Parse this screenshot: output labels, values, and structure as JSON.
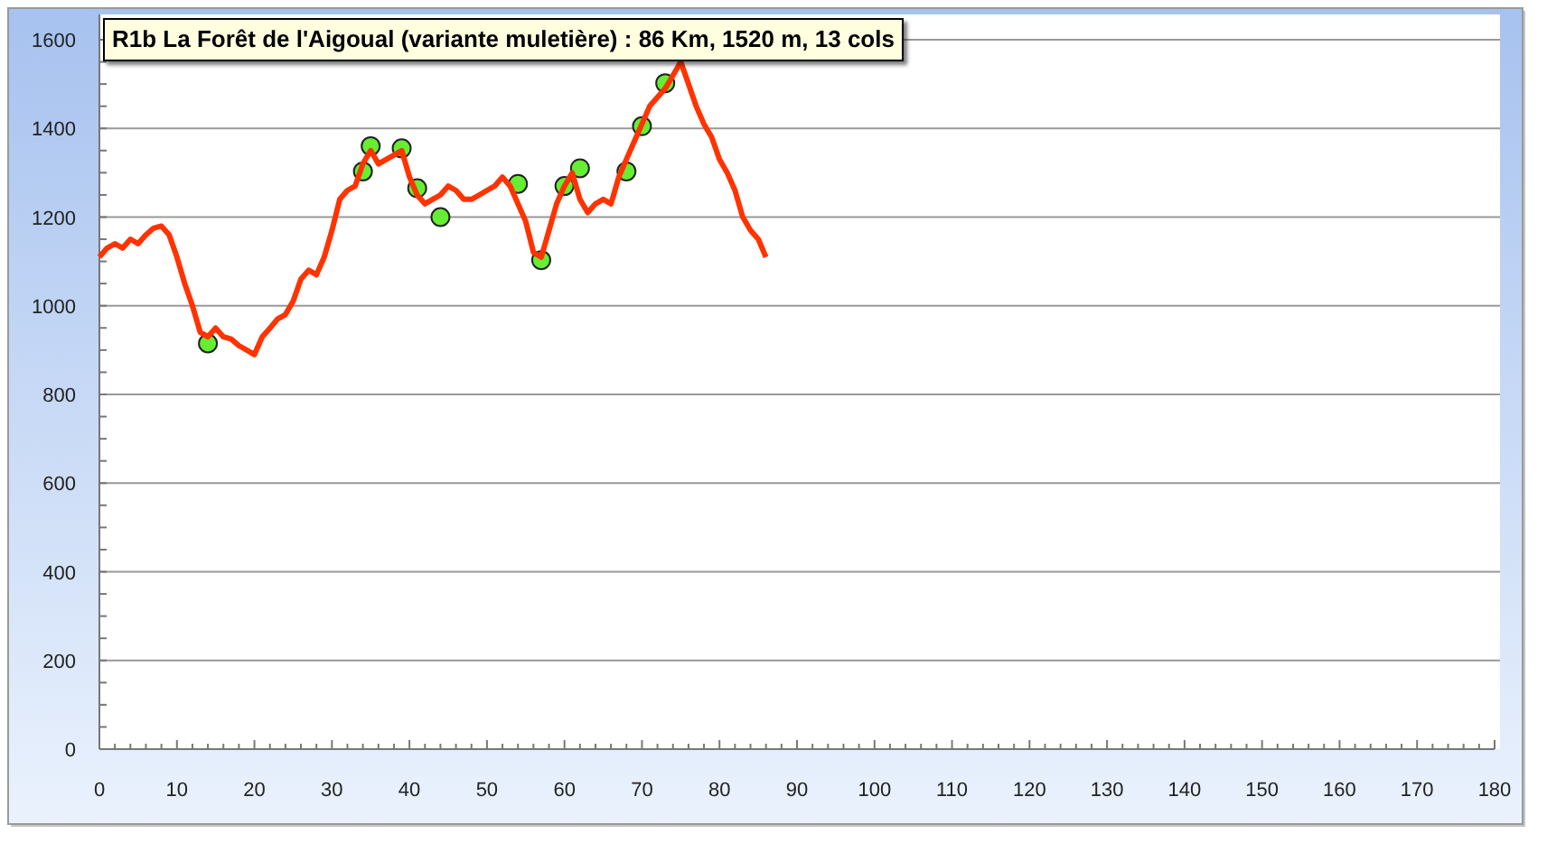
{
  "title": "R1b La Forêt de l'Aigoual (variante muletière) : 86 Km, 1520  m, 13 cols",
  "chart_data": {
    "type": "line",
    "x": [
      0,
      1,
      2,
      3,
      4,
      5,
      6,
      7,
      8,
      9,
      10,
      11,
      12,
      13,
      14,
      15,
      16,
      17,
      18,
      19,
      20,
      21,
      22,
      23,
      24,
      25,
      26,
      27,
      28,
      29,
      30,
      31,
      32,
      33,
      34,
      35,
      36,
      37,
      38,
      39,
      40,
      41,
      42,
      43,
      44,
      45,
      46,
      47,
      48,
      49,
      50,
      51,
      52,
      53,
      54,
      55,
      56,
      57,
      58,
      59,
      60,
      61,
      62,
      63,
      64,
      65,
      66,
      67,
      68,
      69,
      70,
      71,
      72,
      73,
      74,
      75,
      76,
      77,
      78,
      79,
      80,
      81,
      82,
      83,
      84,
      85,
      86
    ],
    "series": [
      {
        "type": "line",
        "color": "#ff3300",
        "values": [
          1110,
          1130,
          1140,
          1130,
          1150,
          1140,
          1160,
          1175,
          1180,
          1160,
          1110,
          1050,
          1000,
          940,
          930,
          950,
          930,
          925,
          910,
          900,
          890,
          930,
          950,
          970,
          980,
          1010,
          1060,
          1080,
          1070,
          1110,
          1170,
          1240,
          1260,
          1270,
          1320,
          1350,
          1320,
          1330,
          1340,
          1350,
          1290,
          1250,
          1230,
          1240,
          1250,
          1270,
          1260,
          1240,
          1240,
          1250,
          1260,
          1270,
          1290,
          1270,
          1230,
          1190,
          1120,
          1110,
          1170,
          1230,
          1270,
          1300,
          1240,
          1210,
          1230,
          1240,
          1230,
          1290,
          1330,
          1370,
          1410,
          1450,
          1470,
          1490,
          1520,
          1550,
          1500,
          1450,
          1410,
          1380,
          1330,
          1300,
          1260,
          1200,
          1170,
          1150,
          1110
        ]
      },
      {
        "type": "scatter",
        "color": "#66ee33",
        "values": [
          null,
          null,
          null,
          null,
          null,
          null,
          null,
          null,
          null,
          null,
          null,
          null,
          null,
          null,
          915,
          null,
          null,
          null,
          null,
          null,
          null,
          null,
          null,
          null,
          null,
          null,
          null,
          null,
          null,
          null,
          null,
          null,
          null,
          null,
          1303,
          1360,
          null,
          null,
          null,
          1355,
          null,
          1265,
          null,
          null,
          1200,
          null,
          null,
          null,
          null,
          null,
          null,
          null,
          null,
          null,
          1275,
          null,
          null,
          1103,
          null,
          null,
          1270,
          null,
          1310,
          null,
          null,
          null,
          null,
          null,
          1303,
          null,
          1405,
          null,
          null,
          1502,
          null,
          null,
          null,
          null,
          null,
          null,
          null,
          null,
          null,
          null,
          null,
          null,
          null
        ]
      }
    ],
    "grid": true,
    "xlim": [
      0,
      180
    ],
    "ylim": [
      0,
      1600
    ],
    "xticks": [
      0,
      10,
      20,
      30,
      40,
      50,
      60,
      70,
      80,
      90,
      100,
      110,
      120,
      130,
      140,
      150,
      160,
      170,
      180
    ],
    "yticks": [
      0,
      200,
      400,
      600,
      800,
      1000,
      1200,
      1400,
      1600
    ]
  }
}
